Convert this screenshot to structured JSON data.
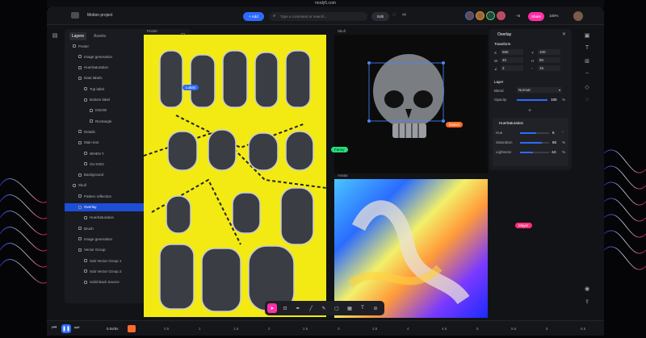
{
  "browser": {
    "url": "mody5.com"
  },
  "topbar": {
    "project_title": "Motion project",
    "add_label": "+ Add",
    "search_placeholder": "Type a command or search...",
    "edit_label": "Edit",
    "extra_collaborators": "+5",
    "share_label": "Share",
    "zoom": "100%"
  },
  "left_panel": {
    "tabs": [
      "Layers",
      "Assets"
    ],
    "layers": [
      {
        "label": "Poster",
        "indent": 0
      },
      {
        "label": "Image generation",
        "indent": 1
      },
      {
        "label": "Hue/Saturation",
        "indent": 1
      },
      {
        "label": "Data labels",
        "indent": 1
      },
      {
        "label": "Top label",
        "indent": 2
      },
      {
        "label": "Bottom label",
        "indent": 2
      },
      {
        "label": "KNOW",
        "indent": 3
      },
      {
        "label": "Rectangle",
        "indent": 3
      },
      {
        "label": "Details",
        "indent": 1
      },
      {
        "label": "Main text",
        "indent": 1
      },
      {
        "label": "WHEN Y",
        "indent": 2
      },
      {
        "label": "OU KNO",
        "indent": 2
      },
      {
        "label": "Background",
        "indent": 1
      },
      {
        "label": "Skull",
        "indent": 0
      },
      {
        "label": "Pattern reflection",
        "indent": 1
      },
      {
        "label": "Overlay",
        "indent": 1,
        "selected": true
      },
      {
        "label": "Hue/Saturation",
        "indent": 2
      },
      {
        "label": "Brush",
        "indent": 1
      },
      {
        "label": "Image generation",
        "indent": 1
      },
      {
        "label": "Vector Group",
        "indent": 1
      },
      {
        "label": "Sub Vector Group 1",
        "indent": 2
      },
      {
        "label": "Sub Vector Group 2",
        "indent": 2
      },
      {
        "label": "Solid Back Source",
        "indent": 2
      }
    ]
  },
  "canvas": {
    "poster_label": "Poster",
    "skull_label": "Skull",
    "avatar_label": "Avatar",
    "poster_tag": "Lukas",
    "skull_tag": "Daniel",
    "avatar_tag_1": "Fanny",
    "avatar_tag_2": "Mayer"
  },
  "right_panel": {
    "title": "Overlay",
    "transform_label": "Transform",
    "x": "560",
    "y": "100",
    "w": "40",
    "h": "80",
    "r": "3",
    "s": "15",
    "unit_px": "px",
    "unit_deg": "°",
    "layer_label": "Layer",
    "blend_label": "Blend",
    "blend_value": "Normal",
    "opacity_label": "Opacity",
    "opacity_value": "100",
    "pct": "%",
    "hue_section": "Hue/Saturation",
    "hue_label": "Hue",
    "hue_value": "5",
    "sat_label": "Saturation",
    "sat_value": "50",
    "light_label": "Lightness",
    "light_value": "-10"
  },
  "bottombar": {
    "time": "0.0s/5s",
    "ticks": [
      "0.5",
      "1",
      "1.5",
      "2",
      "2.5",
      "3",
      "3.5",
      "4",
      "4.5",
      "5",
      "5.5",
      "6",
      "6.5"
    ]
  },
  "colors": {
    "accent": "#2d6bff",
    "share": "#ff2fa8",
    "poster": "#f2ea12",
    "tag_orange": "#ff6a2a",
    "tag_green": "#22e07a",
    "tag_pink": "#ff2f7a"
  }
}
